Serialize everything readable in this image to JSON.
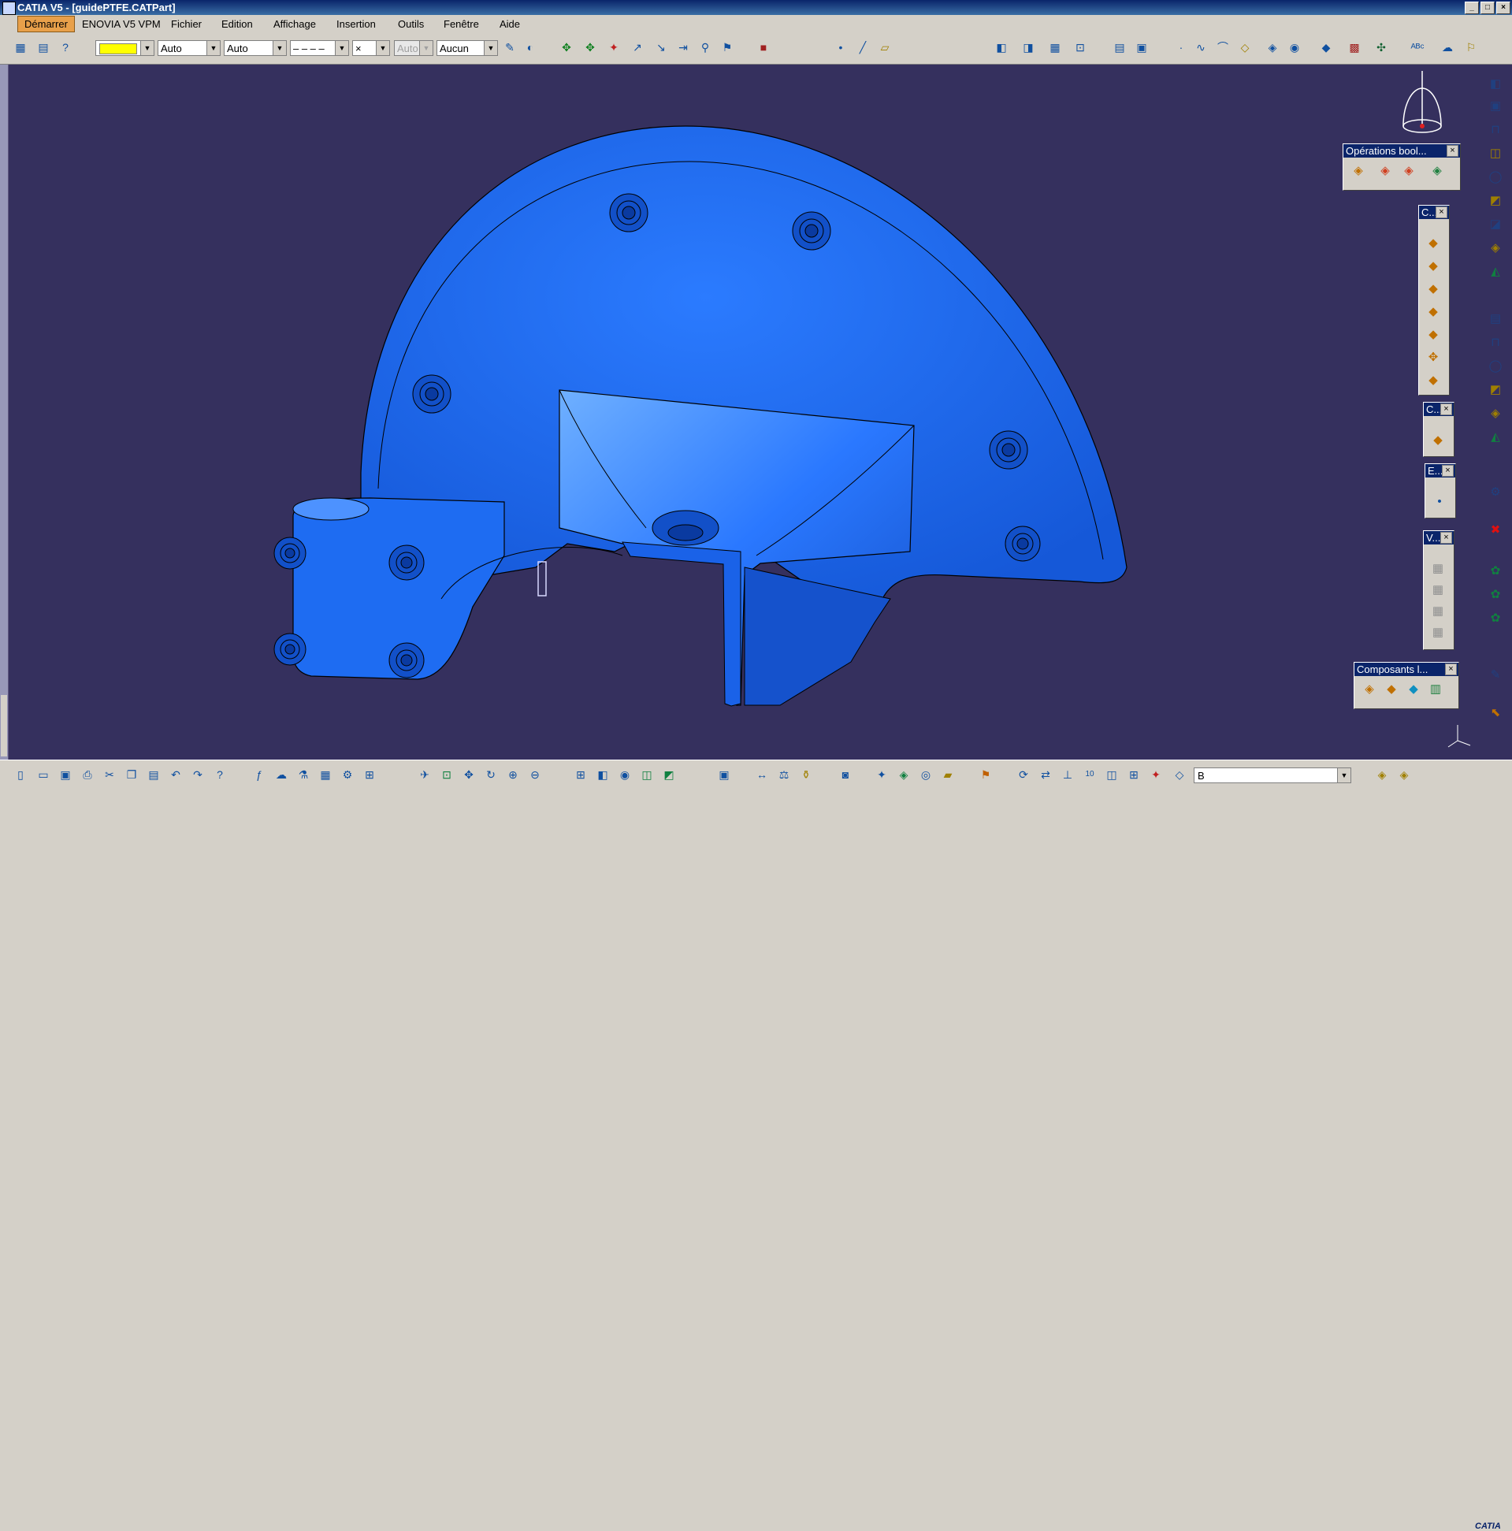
{
  "window": {
    "title": "CATIA V5 - [guidePTFE.CATPart]",
    "controls": [
      "_",
      "□",
      "×"
    ]
  },
  "menu": {
    "start": "Démarrer",
    "items": [
      "ENOVIA V5 VPM",
      "Fichier",
      "Edition",
      "Affichage",
      "Insertion",
      "Outils",
      "Fenêtre",
      "Aide"
    ]
  },
  "properties_toolbar": {
    "color_value": "#ffff00",
    "transparency": "Auto",
    "line_thickness": "Auto",
    "line_type": "– – – –",
    "point_symbol": "×",
    "layer": "Auto",
    "rendering": "Aucun"
  },
  "panels": {
    "boolean_ops": {
      "title": "Opérations bool...",
      "close": "×"
    },
    "c1": {
      "title": "C...",
      "close": "×"
    },
    "c2": {
      "title": "C...",
      "close": "×"
    },
    "e": {
      "title": "E...",
      "close": "×"
    },
    "v": {
      "title": "V...",
      "close": "×"
    },
    "components": {
      "title": "Composants l...",
      "close": "×"
    }
  },
  "command_field": {
    "value": "B"
  },
  "logo": "CATIA",
  "colors": {
    "viewport_bg": "#35305e",
    "part_fill": "#1f6ff5"
  },
  "icons": {
    "top": [
      "sketch-icon",
      "drawing-icon",
      "help-icon",
      "pan-icon",
      "rotate-icon",
      "zoom-icon",
      "apply-material-icon",
      "catalog-icon"
    ],
    "right": [
      "pad-icon",
      "pocket-icon",
      "shaft-icon",
      "hole-icon",
      "rib-icon",
      "fillet-icon",
      "chamfer-icon",
      "shell-icon",
      "draft-icon",
      "thread-icon",
      "measure-icon",
      "analysis-icon"
    ]
  }
}
